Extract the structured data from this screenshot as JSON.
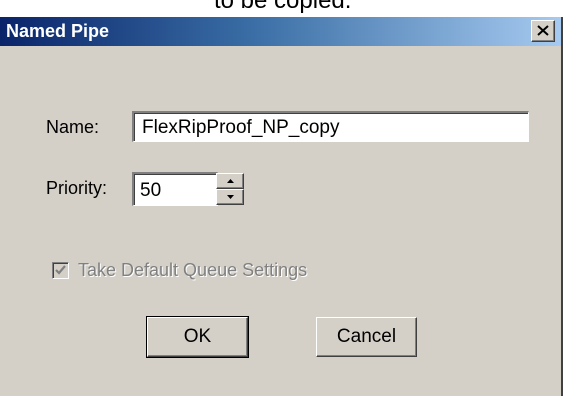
{
  "top_strip": {
    "text": "to be copied."
  },
  "dialog": {
    "title": "Named Pipe",
    "close_icon": "close-x-icon"
  },
  "form": {
    "name_label": "Name:",
    "name_value": "FlexRipProof_NP_copy",
    "priority_label": "Priority:",
    "priority_value": "50",
    "spinner_icons": [
      "up-arrow-icon",
      "down-arrow-icon"
    ],
    "checkbox_label": "Take Default Queue Settings",
    "checkbox_checked": true,
    "checkbox_enabled": false
  },
  "buttons": {
    "ok_label": "OK",
    "cancel_label": "Cancel"
  },
  "colors": {
    "title_start": "#0a246a",
    "title_end": "#a6caf0",
    "face": "#d4d0c8",
    "disabled_text": "#808080"
  }
}
